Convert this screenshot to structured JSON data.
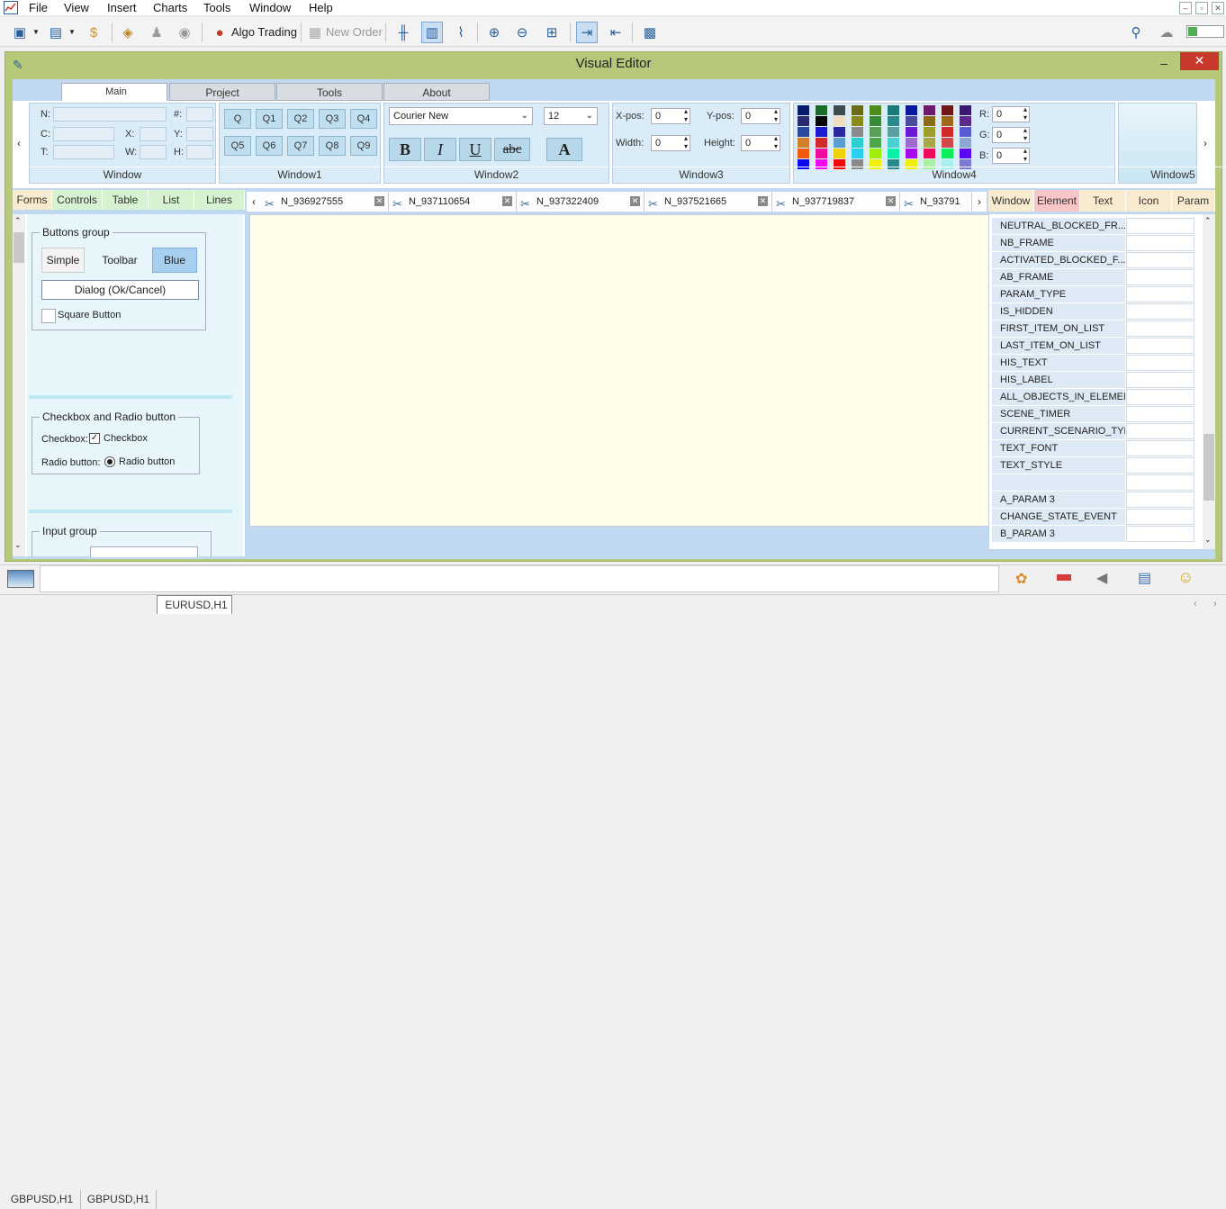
{
  "menu": [
    "File",
    "View",
    "Insert",
    "Charts",
    "Tools",
    "Window",
    "Help"
  ],
  "toolbar": {
    "algo_trading": "Algo Trading",
    "new_order": "New Order"
  },
  "editor": {
    "title": "Visual Editor",
    "close": "✕",
    "minimize": "–"
  },
  "ribbon_tabs": [
    "Main",
    "Project",
    "Tools",
    "About"
  ],
  "window0": {
    "n_label": "N:",
    "hash_label": "#:",
    "c_label": "C:",
    "x_label": "X:",
    "t_label": "T:",
    "w_label": "W:",
    "y_label": "Y:",
    "h_label": "H:",
    "group": "Window"
  },
  "window1": {
    "buttons": [
      "Q",
      "Q1",
      "Q2",
      "Q3",
      "Q4",
      "Q5",
      "Q6",
      "Q7",
      "Q8",
      "Q9"
    ],
    "group": "Window1"
  },
  "window2": {
    "font": "Courier New",
    "size": "12",
    "bold": "B",
    "italic": "I",
    "underline": "U",
    "strike": "abc",
    "color": "A",
    "group": "Window2"
  },
  "window3": {
    "xpos_label": "X-pos:",
    "xpos": "0",
    "ypos_label": "Y-pos:",
    "ypos": "0",
    "width_label": "Width:",
    "width": "0",
    "height_label": "Height:",
    "height": "0",
    "group": "Window3"
  },
  "window4": {
    "r_label": "R:",
    "r": "0",
    "g_label": "G:",
    "g": "0",
    "b_label": "B:",
    "b": "0",
    "group": "Window4"
  },
  "window5": {
    "group": "Window5"
  },
  "palette": [
    "#0a1a6e",
    "#1d6b2a",
    "#3c4e4e",
    "#6b6b1a",
    "#4f8a1a",
    "#1a7a7a",
    "#0a1a9e",
    "#6e1a6e",
    "#6e1a1a",
    "#3a1a6e",
    "#2a2a6e",
    "#050505",
    "#f0dcc0",
    "#8a8a1a",
    "#3a8a3a",
    "#2a8a8a",
    "#4a4a9e",
    "#8a6a1a",
    "#9e6a1a",
    "#5a2a8a",
    "#2a4a9e",
    "#1a1ad0",
    "#2a2a9e",
    "#8a8a8a",
    "#5a9e5a",
    "#5a9e9e",
    "#6a1ad0",
    "#9e9e2a",
    "#d02a2a",
    "#5a5ad0",
    "#d0802a",
    "#d02a2a",
    "#5a9ed0",
    "#2ad0d0",
    "#4aa84a",
    "#4ad0d0",
    "#9e6ad0",
    "#a8a84a",
    "#d04a4a",
    "#8aa8d0",
    "#f05a0a",
    "#f00a9e",
    "#f0d00a",
    "#2ad0f0",
    "#9ef00a",
    "#0af0a8",
    "#a80af0",
    "#f00a5a",
    "#0af05a",
    "#5a0af0",
    "#0a0af0",
    "#f00af0",
    "#f00a0a",
    "#8a8a8a",
    "#f0f00a",
    "#2a8a8a",
    "#f0f00a",
    "#a8f0a8",
    "#a8f0f0",
    "#7a7ad0"
  ],
  "left_tabs": [
    "Forms",
    "Controls",
    "Table",
    "List",
    "Lines"
  ],
  "chart_tabs": [
    "N_936927555",
    "N_937110654",
    "N_937322409",
    "N_937521665",
    "N_937719837",
    "N_93791"
  ],
  "right_tabs": [
    "Window",
    "Element",
    "Text",
    "Icon",
    "Param"
  ],
  "forms": {
    "buttons_group": "Buttons group",
    "simple": "Simple",
    "toolbar": "Toolbar",
    "blue": "Blue",
    "dialog": "Dialog   (Ok/Cancel)",
    "square": "Square Button",
    "check_group": "Checkbox and Radio button",
    "checkbox_label": "Checkbox:",
    "checkbox": "Checkbox",
    "radio_label": "Radio button:",
    "radio": "Radio button",
    "input_group": "Input group"
  },
  "element_props": [
    "NEUTRAL_BLOCKED_FR...",
    "NB_FRAME",
    "ACTIVATED_BLOCKED_F...",
    "AB_FRAME",
    "PARAM_TYPE",
    "IS_HIDDEN",
    "FIRST_ITEM_ON_LIST",
    "LAST_ITEM_ON_LIST",
    "HIS_TEXT",
    "HIS_LABEL",
    "ALL_OBJECTS_IN_ELEMENT",
    "SCENE_TIMER",
    "CURRENT_SCENARIO_TYPE",
    "TEXT_FONT",
    "TEXT_STYLE",
    "",
    "A_PARAM 3",
    "CHANGE_STATE_EVENT",
    "B_PARAM 3"
  ],
  "sheets": [
    "GBPUSD,H1",
    "GBPUSD,H1",
    "EURUSD,H1"
  ]
}
